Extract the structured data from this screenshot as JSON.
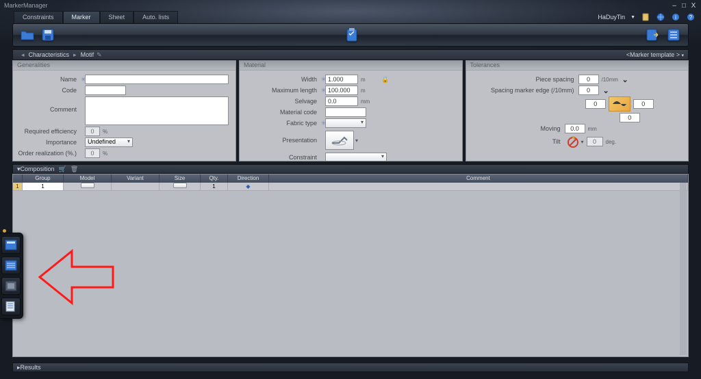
{
  "app_title": "MarkerManager",
  "window_buttons": {
    "min": "–",
    "max": "□",
    "close": "X"
  },
  "tabs": [
    "Constraints",
    "Marker",
    "Sheet",
    "Auto. lists"
  ],
  "active_tab_index": 1,
  "user_menu": "HaDuyTin",
  "breadcrumb": {
    "back": "◂",
    "item1": "Characteristics",
    "item2": "Motif"
  },
  "template_label": "<Marker template >",
  "panels": {
    "generalities": {
      "title": "Generalities",
      "name_label": "Name",
      "name_value": "",
      "code_label": "Code",
      "code_value": "",
      "comment_label": "Comment",
      "comment_value": "",
      "reqeff_label": "Required efficiency",
      "reqeff_value": "0",
      "reqeff_unit": "%",
      "importance_label": "Importance",
      "importance_value": "Undefined",
      "orderreal_label": "Order realization (%.)",
      "orderreal_value": "0",
      "orderreal_unit": "%"
    },
    "material": {
      "title": "Material",
      "width_label": "Width",
      "width_value": "1.000",
      "width_unit": "m",
      "maxlen_label": "Maximum length",
      "maxlen_value": "100.000",
      "maxlen_unit": "m",
      "selvage_label": "Selvage",
      "selvage_value": "0.0",
      "selvage_unit": "mm",
      "matcode_label": "Material code",
      "matcode_value": "",
      "fabrictype_label": "Fabric type",
      "fabrictype_value": "",
      "presentation_label": "Presentation",
      "constraint_label": "Constraint",
      "constraint_value": ""
    },
    "tolerances": {
      "title": "Tolerances",
      "piecespacing_label": "Piece spacing",
      "piecespacing_value": "0",
      "piecespacing_unit": "/10mm",
      "edge_label": "Spacing marker edge (/10mm)",
      "edge_value": "0",
      "left_value": "0",
      "right_value": "0",
      "bottom_value": "0",
      "moving_label": "Moving",
      "moving_value": "0.0",
      "moving_unit": "mm",
      "tilt_label": "Tilt",
      "tilt_value": "0",
      "tilt_unit": "deg."
    }
  },
  "composition": {
    "title": "Composition",
    "columns": [
      "",
      "Group",
      "Model",
      "Variant",
      "Size",
      "Qty.",
      "Direction",
      "Comment"
    ],
    "row": {
      "num": "1",
      "group": "1",
      "model": "",
      "variant": "",
      "size": "",
      "qty": "1",
      "direction": "◆",
      "comment": ""
    }
  },
  "results_title": "Results",
  "colors": {
    "accent_orange": "#e9a83f",
    "accent_blue": "#3a7bd5"
  }
}
